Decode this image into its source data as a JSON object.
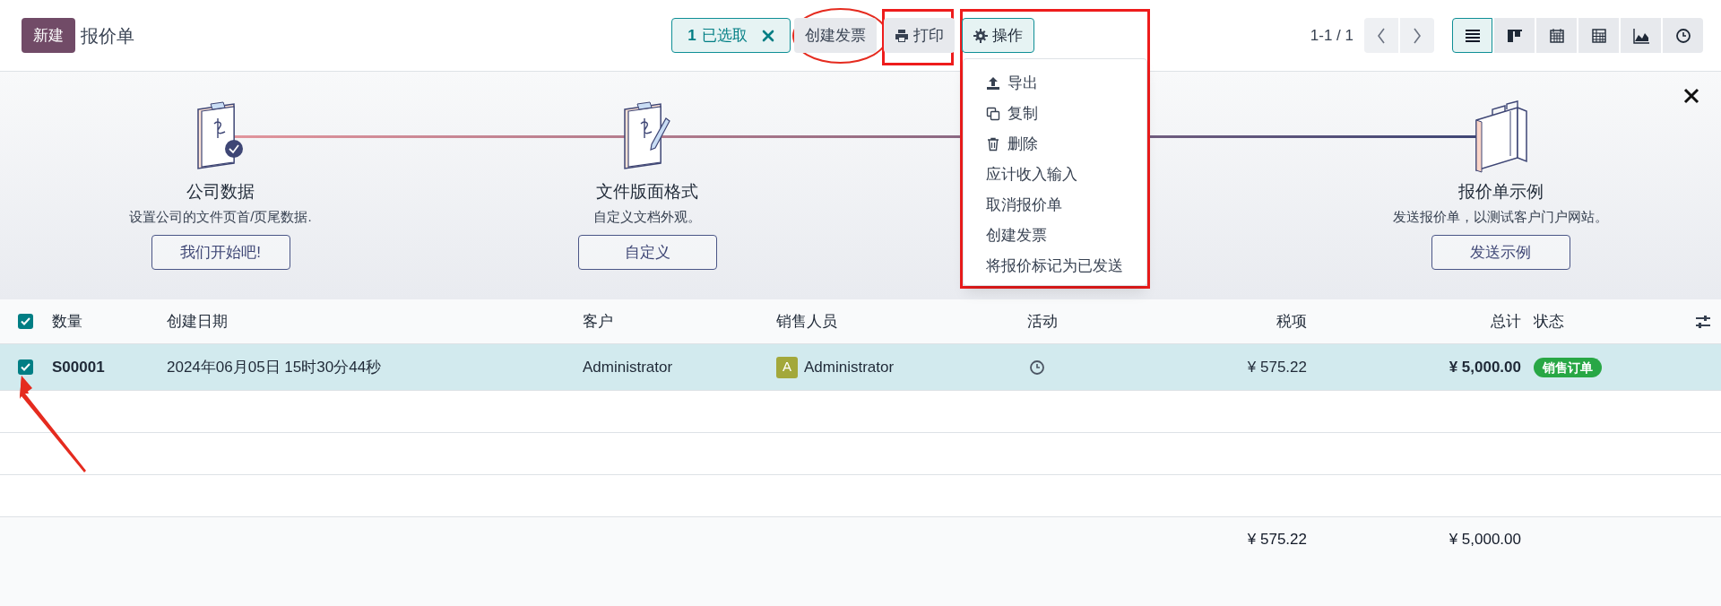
{
  "control_panel": {
    "new_button": "新建",
    "breadcrumb": "报价单",
    "selection": {
      "count": "1",
      "label": "已选取"
    },
    "buttons": [
      {
        "kind": "invoice",
        "label": "创建发票",
        "circled": true,
        "boxed": false,
        "expanded": false
      },
      {
        "kind": "print",
        "label": "打印",
        "circled": false,
        "boxed": true,
        "expanded": false
      },
      {
        "kind": "actions",
        "label": "操作",
        "circled": false,
        "boxed": true,
        "expanded": true
      }
    ],
    "pager": "1-1 / 1",
    "views": [
      {
        "kind": "list",
        "selected": true
      },
      {
        "kind": "kanban",
        "selected": false
      },
      {
        "kind": "calendar",
        "selected": false
      },
      {
        "kind": "pivot",
        "selected": false
      },
      {
        "kind": "graph",
        "selected": false
      },
      {
        "kind": "activity",
        "selected": false
      }
    ]
  },
  "actions_menu": [
    {
      "kind": "export",
      "label": "导出"
    },
    {
      "kind": "copy",
      "label": "复制"
    },
    {
      "kind": "delete",
      "label": "删除"
    },
    {
      "kind": "text",
      "label": "应计收入输入"
    },
    {
      "kind": "text",
      "label": "取消报价单"
    },
    {
      "kind": "text",
      "label": "创建发票"
    },
    {
      "kind": "text",
      "label": "将报价标记为已发送"
    }
  ],
  "onboarding": {
    "steps": [
      {
        "kind": "company",
        "title": "公司数据",
        "description": "设置公司的文件页首/页尾数据.",
        "button": "我们开始吧!"
      },
      {
        "kind": "layout",
        "title": "文件版面格式",
        "description": "自定义文档外观。",
        "button": "自定义"
      },
      {
        "kind": "sample",
        "title": "报价单示例",
        "description": "发送报价单，以测试客户门户网站。",
        "button": "发送示例"
      }
    ]
  },
  "table": {
    "all_selected": true,
    "columns": [
      "数量",
      "创建日期",
      "客户",
      "销售人员",
      "活动",
      "税项",
      "总计",
      "状态"
    ],
    "rows": [
      {
        "selected": true,
        "arrow": true,
        "number": "S00001",
        "date": "2024年06月05日 15时30分44秒",
        "customer": "Administrator",
        "salesperson": {
          "initial": "A",
          "name": "Administrator",
          "color": "#a3a83b"
        },
        "tax": "¥ 575.22",
        "total": "¥ 5,000.00",
        "status": "销售订单"
      }
    ],
    "totals": {
      "tax": "¥ 575.22",
      "total": "¥ 5,000.00"
    }
  }
}
